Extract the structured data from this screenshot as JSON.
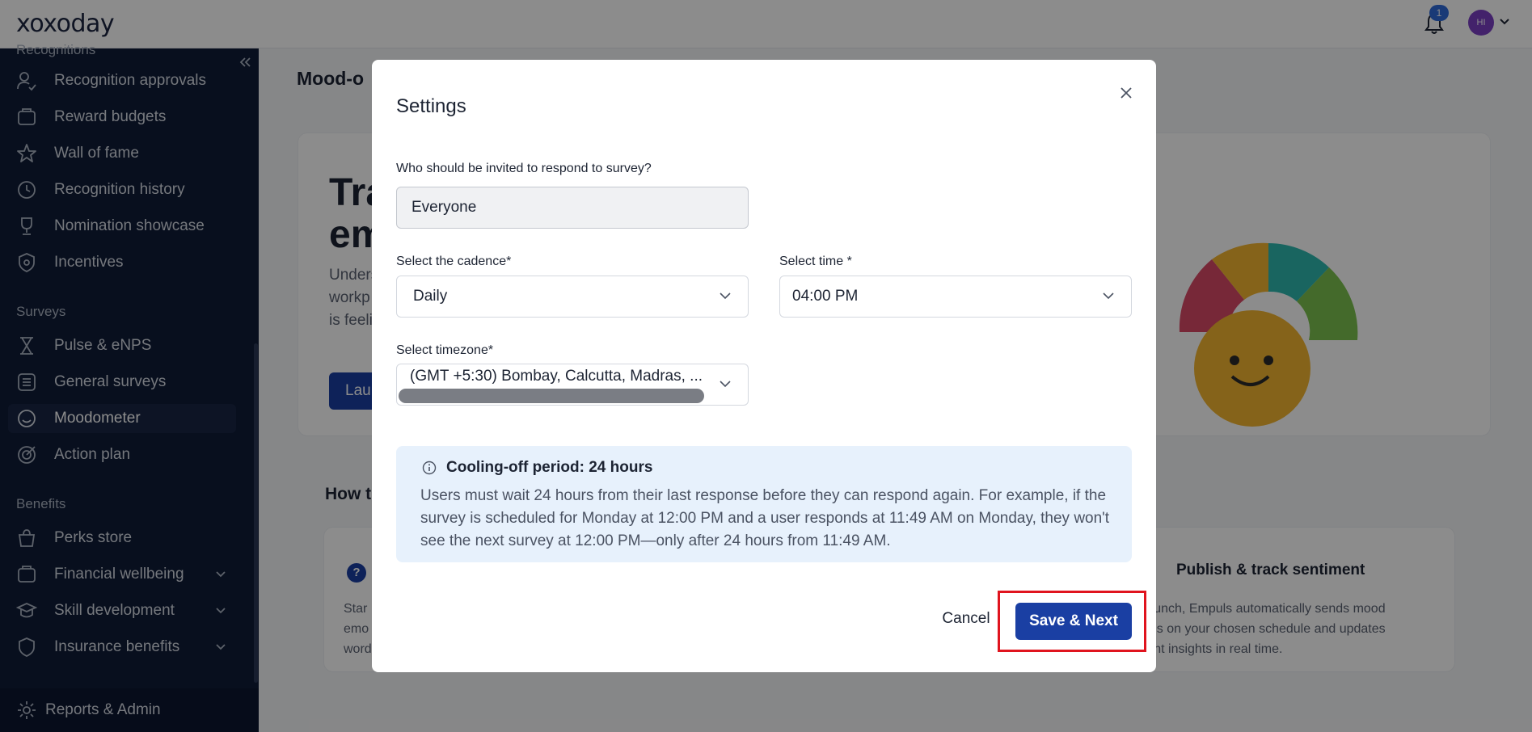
{
  "topbar": {
    "logo": "xoxoday",
    "notification_count": "1",
    "avatar_initials": "HI"
  },
  "sidebar": {
    "top_cut_heading": "Recognitions",
    "recognition_items": [
      {
        "label": "Recognition approvals",
        "icon": "person-check-icon"
      },
      {
        "label": "Reward budgets",
        "icon": "wallet-icon"
      },
      {
        "label": "Wall of fame",
        "icon": "star-icon"
      },
      {
        "label": "Recognition history",
        "icon": "history-icon"
      },
      {
        "label": "Nomination showcase",
        "icon": "trophy-icon"
      },
      {
        "label": "Incentives",
        "icon": "shield-icon"
      }
    ],
    "surveys_heading": "Surveys",
    "survey_items": [
      {
        "label": "Pulse & eNPS",
        "icon": "hourglass-icon"
      },
      {
        "label": "General surveys",
        "icon": "list-icon"
      },
      {
        "label": "Moodometer",
        "icon": "smile-icon"
      },
      {
        "label": "Action plan",
        "icon": "target-icon"
      }
    ],
    "benefits_heading": "Benefits",
    "benefit_items": [
      {
        "label": "Perks store",
        "icon": "bag-icon"
      },
      {
        "label": "Financial wellbeing",
        "icon": "wallet-icon"
      },
      {
        "label": "Skill development",
        "icon": "graduation-icon"
      },
      {
        "label": "Insurance benefits",
        "icon": "shield-icon"
      }
    ],
    "reports_label": "Reports & Admin"
  },
  "main": {
    "page_title": "Mood-o",
    "hero_title_line1": "Tra",
    "hero_title_line2": "em",
    "hero_text_line1": "Unders",
    "hero_text_line2": "workp",
    "hero_text_line3": "is feeli",
    "hero_button": "Lau",
    "howto_title": "How t",
    "step1_text_line1": "Star",
    "step1_text_line2": "emo",
    "step1_text_line3": "word",
    "step3_title": "Publish & track sentiment",
    "step3_text_line1": "r launch, Empuls automatically sends mood",
    "step3_text_line2": "k-ins on your chosen schedule and updates",
    "step3_text_line3": "ment insights in real time."
  },
  "modal": {
    "title": "Settings",
    "invite_label": "Who should be invited to respond to survey?",
    "invite_value": "Everyone",
    "cadence_label": "Select the cadence*",
    "cadence_value": "Daily",
    "time_label": "Select time *",
    "time_value": "04:00 PM",
    "timezone_label": "Select timezone*",
    "timezone_value": "(GMT +5:30) Bombay, Calcutta, Madras, ...",
    "info_title": "Cooling-off period: 24 hours",
    "info_text": "Users must wait 24 hours from their last response before they can respond again. For example, if the survey is scheduled for Monday at 12:00 PM and a user responds at 11:49 AM on Monday, they won't see the next survey at 12:00 PM—only after 24 hours from 11:49 AM.",
    "cancel_label": "Cancel",
    "save_label": "Save & Next"
  },
  "colors": {
    "sidebar_bg": "#0f1c38",
    "primary": "#1a3fa3",
    "info_bg": "#e7f1fc",
    "highlight": "#e0141e"
  }
}
